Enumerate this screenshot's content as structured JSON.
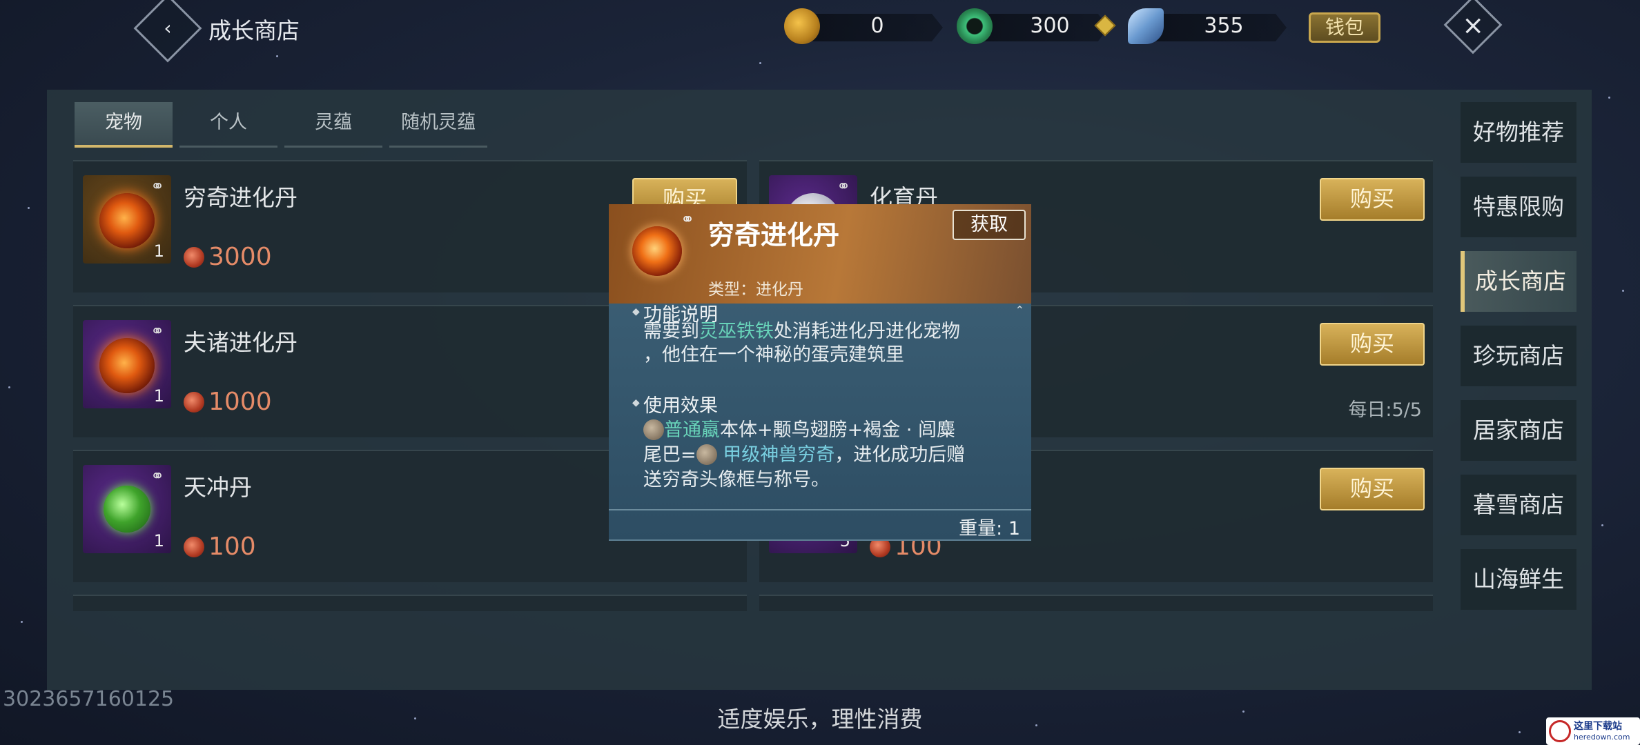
{
  "header": {
    "title": "成长商店",
    "back_icon": "back-chevron-icon",
    "currencies": [
      {
        "icon": "gourd-coin-icon",
        "value": "0"
      },
      {
        "icon": "jade-ring-icon",
        "value": "300"
      },
      {
        "icon": "feather-gem-icon",
        "value": "355"
      }
    ],
    "wallet_label": "钱包",
    "close_icon": "close-icon"
  },
  "tabs": [
    {
      "label": "宠物",
      "active": true
    },
    {
      "label": "个人",
      "active": false
    },
    {
      "label": "灵蕴",
      "active": false
    },
    {
      "label": "随机灵蕴",
      "active": false
    }
  ],
  "items_left": [
    {
      "name": "穷奇进化丹",
      "qty": "1",
      "price": "3000",
      "buy": "购买"
    },
    {
      "name": "夫诸进化丹",
      "qty": "1",
      "price": "1000"
    },
    {
      "name": "天冲丹",
      "qty": "1",
      "price": "100"
    }
  ],
  "items_right": [
    {
      "name": "化育丹",
      "buy": "购买"
    },
    {
      "buy": "购买",
      "daily": "每日:5/5"
    },
    {
      "buy": "购买",
      "qty": "5",
      "price": "100"
    }
  ],
  "sidebar": {
    "items": [
      {
        "label": "好物推荐"
      },
      {
        "label": "特惠限购"
      },
      {
        "label": "成长商店",
        "active": true
      },
      {
        "label": "珍玩商店"
      },
      {
        "label": "居家商店"
      },
      {
        "label": "暮雪商店"
      },
      {
        "label": "山海鲜生"
      }
    ]
  },
  "popup": {
    "name": "穷奇进化丹",
    "get_label": "获取",
    "type_line": "类型：进化丹",
    "section1_title": "功能说明",
    "s1_a": "需要到",
    "s1_hl": "灵巫铁铁",
    "s1_b": "处消耗进化丹进化宠物",
    "s1_line2": "，他住在一个神秘的蛋壳建筑里",
    "section2_title": "使用效果",
    "s2_hl": "普通蠃",
    "s2_a": "本体+颙鸟翅膀+褐金 · 闾麋",
    "s2_b": "尾巴=",
    "s2_hl2": "甲级神兽穷奇",
    "s2_c": "，进化成功后赠",
    "s2_line3": "送穷奇头像框与称号。",
    "weight": "重量: 1"
  },
  "footer": {
    "uid": "3023657160125",
    "slogan": "适度娱乐，理性消费",
    "watermark_title": "这里下载站",
    "watermark_sub": "heredown.com"
  },
  "colors": {
    "accent_gold": "#d8b25a",
    "price_red": "#e58b68",
    "highlight_green": "#68d3b9"
  }
}
